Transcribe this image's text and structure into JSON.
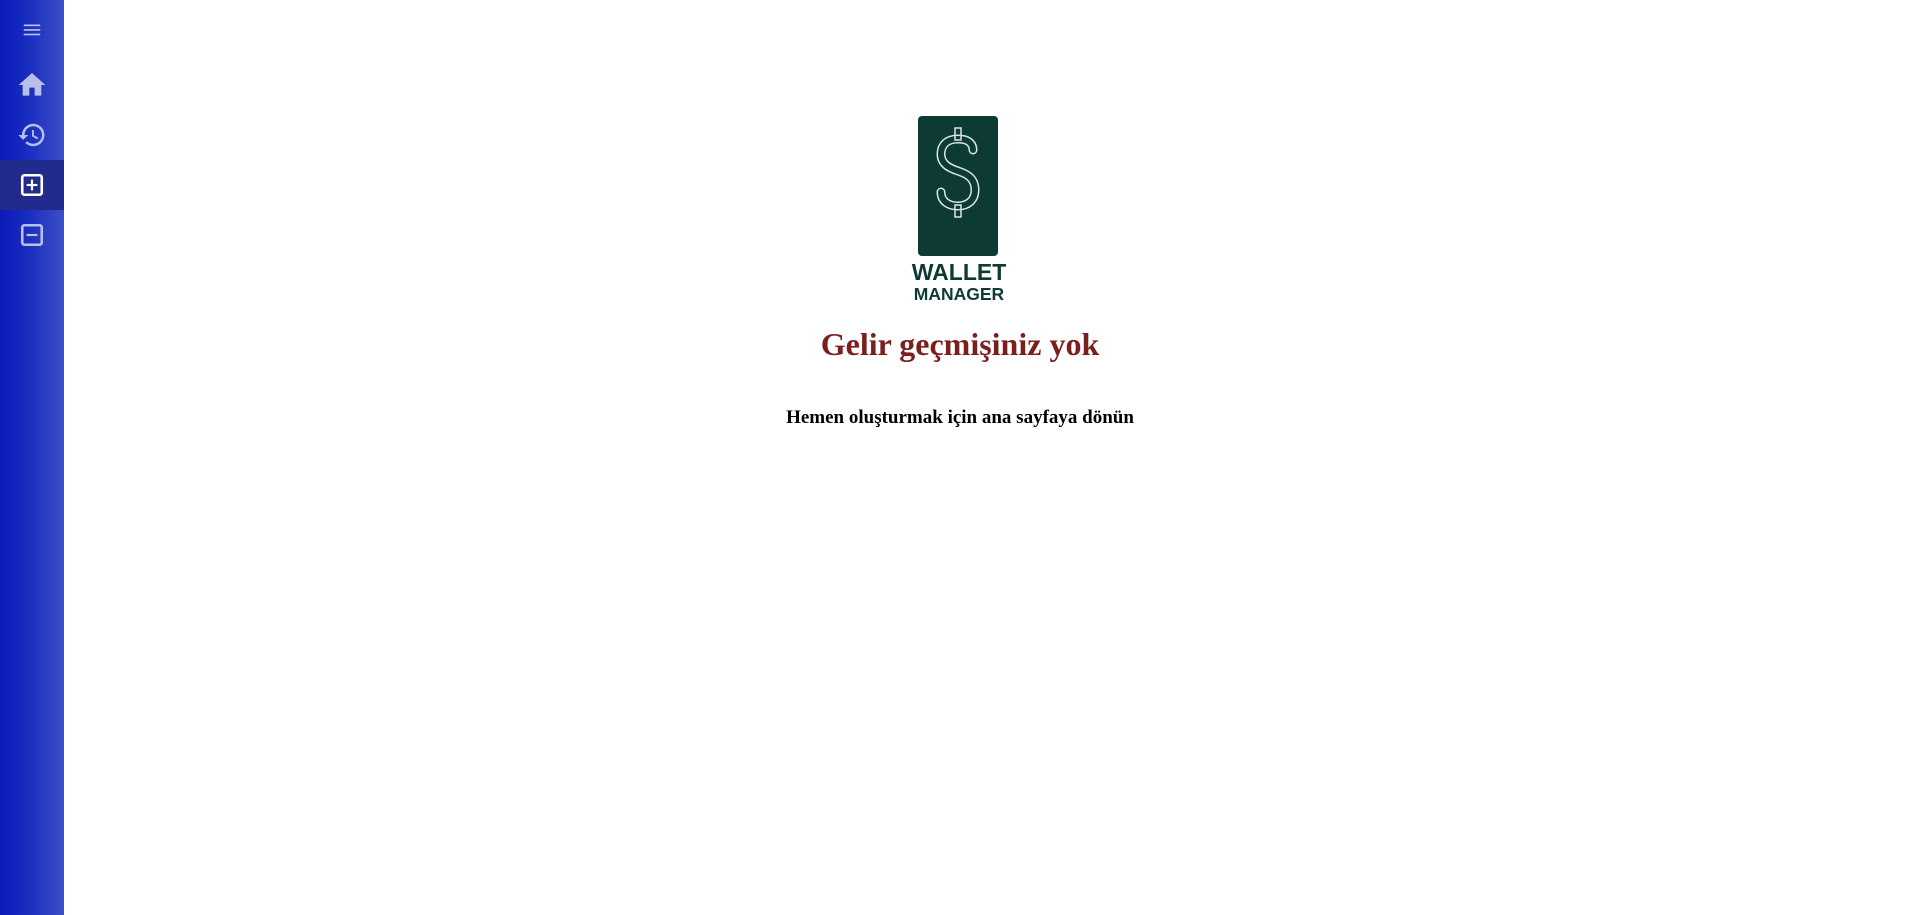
{
  "sidebar": {
    "items": [
      {
        "icon": "menu-icon",
        "active": false
      },
      {
        "icon": "home-icon",
        "active": false
      },
      {
        "icon": "history-icon",
        "active": false
      },
      {
        "icon": "add-box-icon",
        "active": true
      },
      {
        "icon": "minus-box-icon",
        "active": false
      }
    ],
    "colors": {
      "gradient_start": "#0a1ab8",
      "gradient_end": "#3b4fc6",
      "active_background": "#212a8d",
      "icon_inactive": "#b9bfe9",
      "icon_active": "#ffffff"
    }
  },
  "logo": {
    "line1": "WALLET",
    "line2": "MANAGER",
    "symbol": "$",
    "color": "#0d3b34"
  },
  "main": {
    "title": "Gelir geçmişiniz yok",
    "subtitle": "Hemen oluşturmak için ana sayfaya dönün",
    "title_color": "#7a1e1e"
  }
}
